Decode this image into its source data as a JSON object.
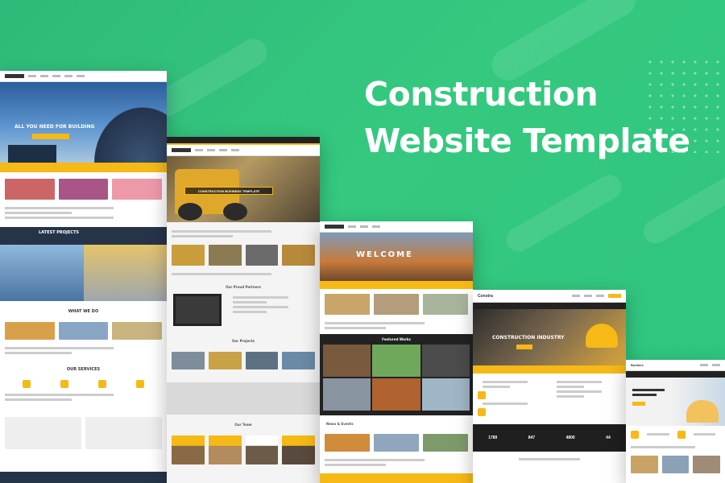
{
  "headline": {
    "line1": "Construction",
    "line2": "Website Template"
  },
  "previews": {
    "p1": {
      "hero_text": "ALL YOU NEED FOR BUILDING",
      "section_latest": "LATEST PROJECTS",
      "section_what": "WHAT WE DO",
      "section_services": "OUR SERVICES"
    },
    "p2": {
      "hero_banner": "CONSTRUCTION BUSINESS TEMPLATE",
      "section_partners": "Our Proud Partners",
      "section_projects": "Our Projects",
      "section_team": "Our Team"
    },
    "p3": {
      "hero_text": "WELCOME",
      "section_featured": "Featured Works",
      "section_news": "News & Events"
    },
    "p4": {
      "logo": "Constra",
      "hero_text": "CONSTRUCTION INDUSTRY",
      "stat_values": [
        "1789",
        "847",
        "4800",
        "44"
      ]
    },
    "p5": {
      "logo": "Builderz"
    }
  },
  "colors": {
    "background": "#35c97f",
    "accent": "#f6b916",
    "dark": "#1e2732"
  }
}
